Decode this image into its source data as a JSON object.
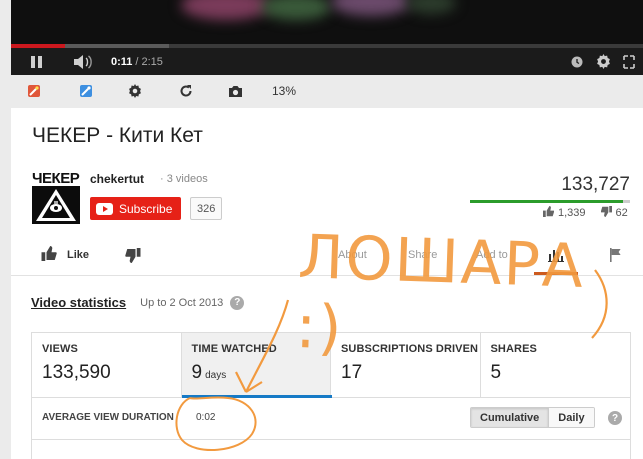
{
  "player": {
    "current_time": "0:11",
    "separator": "/",
    "duration": "2:15",
    "progress_played": 0.085,
    "progress_buffered": 0.25
  },
  "toolbar": {
    "zoom_percent": "13%",
    "icons": [
      "magic-wand-icon",
      "enhance-wand-icon",
      "gear-icon",
      "rotate-icon",
      "camera-icon"
    ]
  },
  "video": {
    "title": "ЧЕКЕР - Кити Кет",
    "views": "133,727",
    "likes": "1,339",
    "dislikes": "62",
    "like_ratio": 0.955
  },
  "channel": {
    "logo_text": "ЧЕКЕР",
    "name": "chekertut",
    "video_count": "· 3 videos",
    "subscribe_label": "Subscribe",
    "subscriber_count": "326"
  },
  "actions": {
    "like_label": "Like",
    "about_label": "About",
    "share_label": "Share",
    "add_to_label": "Add to"
  },
  "stats": {
    "title": "Video statistics",
    "date_range": "Up to 2 Oct 2013",
    "metrics": [
      {
        "label": "VIEWS",
        "value": "133,590",
        "unit": ""
      },
      {
        "label": "TIME WATCHED",
        "value": "9",
        "unit": "days"
      },
      {
        "label": "SUBSCRIPTIONS DRIVEN",
        "value": "17",
        "unit": ""
      },
      {
        "label": "SHARES",
        "value": "5",
        "unit": ""
      }
    ],
    "avg_label": "AVERAGE VIEW DURATION",
    "avg_value": "0:02",
    "cumulative_label": "Cumulative",
    "daily_label": "Daily"
  },
  "overlay": {
    "handwriting": "ЛОШАРА :)",
    "color": "#f29a3f"
  },
  "colors": {
    "subscribe_red": "#e62117",
    "active_blue": "#167ac6",
    "like_green": "#2b9c2b",
    "tab_orange": "#cc5a1e"
  }
}
